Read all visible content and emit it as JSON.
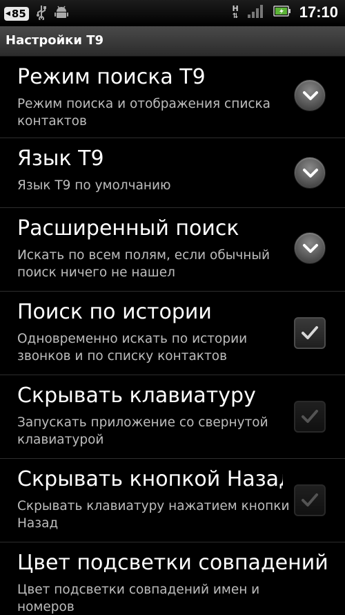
{
  "status_bar": {
    "notification_count": "85",
    "time": "17:10",
    "network_type": "H"
  },
  "header": {
    "title": "Настройки T9"
  },
  "settings": [
    {
      "title": "Режим поиска T9",
      "summary": "Режим поиска и отображения списка контактов",
      "widget": "dropdown"
    },
    {
      "title": "Язык T9",
      "summary": "Язык T9 по умолчанию",
      "widget": "dropdown"
    },
    {
      "title": "Расширенный поиск",
      "summary": "Искать по всем полям, если обычный поиск ничего не нашел",
      "widget": "dropdown"
    },
    {
      "title": "Поиск по истории",
      "summary": "Одновременно искать по истории звонков и по списку контактов",
      "widget": "checkbox",
      "checked": true,
      "enabled": true
    },
    {
      "title": "Скрывать клавиатуру",
      "summary": "Запускать приложение со свернутой клавиатурой",
      "widget": "checkbox",
      "checked": true,
      "enabled": false
    },
    {
      "title": "Скрывать кнопкой Назад",
      "summary": "Скрывать клавиатуру нажатием кнопки Назад",
      "widget": "checkbox",
      "checked": true,
      "enabled": false
    },
    {
      "title": "Цвет подсветки совпадений",
      "summary": "Цвет подсветки совпадений имен и номеров",
      "widget": "none"
    }
  ],
  "icons": {
    "usb": "usb-icon",
    "android_debug": "android-debug-icon",
    "signal": "signal-icon",
    "battery": "battery-icon"
  }
}
